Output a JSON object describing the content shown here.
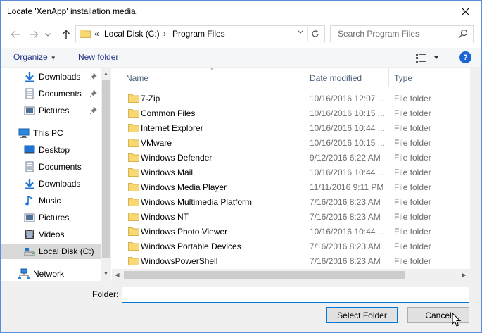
{
  "window": {
    "title": "Locate 'XenApp' installation media."
  },
  "address": {
    "chevron": "«",
    "crumbs": [
      "Local Disk (C:)",
      "Program Files"
    ],
    "separator": "›"
  },
  "search": {
    "placeholder": "Search Program Files"
  },
  "toolbar": {
    "organize_label": "Organize",
    "new_folder_label": "New folder",
    "help_label": "?"
  },
  "nav": {
    "quick_access": [
      {
        "label": "Downloads",
        "icon": "download-arrow-icon",
        "pinned": true
      },
      {
        "label": "Documents",
        "icon": "documents-icon",
        "pinned": true
      },
      {
        "label": "Pictures",
        "icon": "pictures-icon",
        "pinned": true
      }
    ],
    "this_pc": {
      "label": "This PC",
      "icon": "computer-icon"
    },
    "pc_items": [
      {
        "label": "Desktop",
        "icon": "desktop-icon"
      },
      {
        "label": "Documents",
        "icon": "documents-icon"
      },
      {
        "label": "Downloads",
        "icon": "download-arrow-icon"
      },
      {
        "label": "Music",
        "icon": "music-note-icon"
      },
      {
        "label": "Pictures",
        "icon": "pictures-icon"
      },
      {
        "label": "Videos",
        "icon": "videos-icon"
      },
      {
        "label": "Local Disk (C:)",
        "icon": "drive-icon",
        "selected": true
      }
    ],
    "network": {
      "label": "Network",
      "icon": "network-icon"
    }
  },
  "columns": {
    "name": "Name",
    "date": "Date modified",
    "type": "Type"
  },
  "files": [
    {
      "name": "7-Zip",
      "date": "10/16/2016 12:07 ...",
      "type": "File folder"
    },
    {
      "name": "Common Files",
      "date": "10/16/2016 10:15 ...",
      "type": "File folder"
    },
    {
      "name": "Internet Explorer",
      "date": "10/16/2016 10:44 ...",
      "type": "File folder"
    },
    {
      "name": "VMware",
      "date": "10/16/2016 10:15 ...",
      "type": "File folder"
    },
    {
      "name": "Windows Defender",
      "date": "9/12/2016 6:22 AM",
      "type": "File folder"
    },
    {
      "name": "Windows Mail",
      "date": "10/16/2016 10:44 ...",
      "type": "File folder"
    },
    {
      "name": "Windows Media Player",
      "date": "11/11/2016 9:11 PM",
      "type": "File folder"
    },
    {
      "name": "Windows Multimedia Platform",
      "date": "7/16/2016 8:23 AM",
      "type": "File folder"
    },
    {
      "name": "Windows NT",
      "date": "7/16/2016 8:23 AM",
      "type": "File folder"
    },
    {
      "name": "Windows Photo Viewer",
      "date": "10/16/2016 10:44 ...",
      "type": "File folder"
    },
    {
      "name": "Windows Portable Devices",
      "date": "7/16/2016 8:23 AM",
      "type": "File folder"
    },
    {
      "name": "WindowsPowerShell",
      "date": "7/16/2016 8:23 AM",
      "type": "File folder"
    }
  ],
  "footer": {
    "folder_label": "Folder:",
    "folder_value": "",
    "select_label": "Select Folder",
    "cancel_label": "Cancel"
  },
  "colors": {
    "accent": "#0078d7",
    "folder": "#f8d775",
    "help": "#1c63d4",
    "selected_nav": "#d9d9d9"
  }
}
